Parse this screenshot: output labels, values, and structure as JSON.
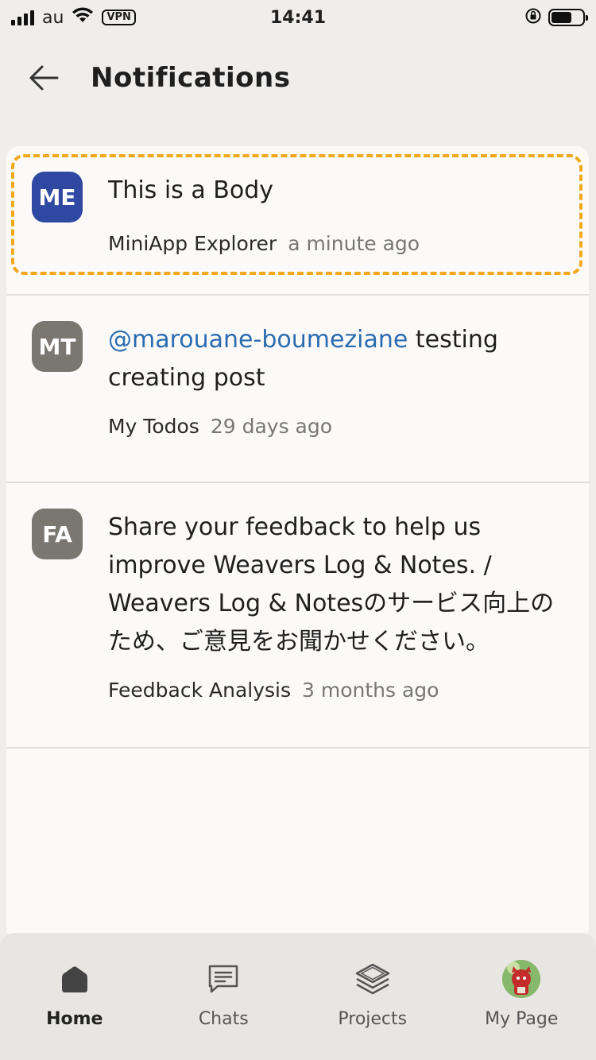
{
  "status_bar": {
    "carrier": "au",
    "vpn": "VPN",
    "time": "14:41",
    "battery_level": 0.65
  },
  "header": {
    "title": "Notifications"
  },
  "notifications": [
    {
      "avatar_initials": "ME",
      "avatar_color": "#2f49a3",
      "body": "This is a Body",
      "mention": "",
      "source": "MiniApp Explorer",
      "time": "a minute ago",
      "highlighted": true
    },
    {
      "avatar_initials": "MT",
      "avatar_color": "#7a7670",
      "mention": "@marouane-boumeziane",
      "body": " testing creating post",
      "source": "My Todos",
      "time": "29 days ago",
      "highlighted": false
    },
    {
      "avatar_initials": "FA",
      "avatar_color": "#7a7670",
      "body": "Share your feedback to help us improve Weavers Log & Notes. / Weavers Log & Notesのサービス向上のため、ご意見をお聞かせください。",
      "mention": "",
      "source": "Feedback Analysis",
      "time": "3 months ago",
      "highlighted": false
    }
  ],
  "tabbar": {
    "tabs": [
      {
        "label": "Home",
        "icon": "home-icon",
        "active": true
      },
      {
        "label": "Chats",
        "icon": "chat-icon",
        "active": false
      },
      {
        "label": "Projects",
        "icon": "layers-icon",
        "active": false
      },
      {
        "label": "My Page",
        "icon": "avatar",
        "active": false
      }
    ]
  },
  "colors": {
    "accent_highlight": "#f2a81d",
    "mention": "#2b6cb0",
    "background": "#efeeec",
    "card": "#fbfaf8"
  }
}
